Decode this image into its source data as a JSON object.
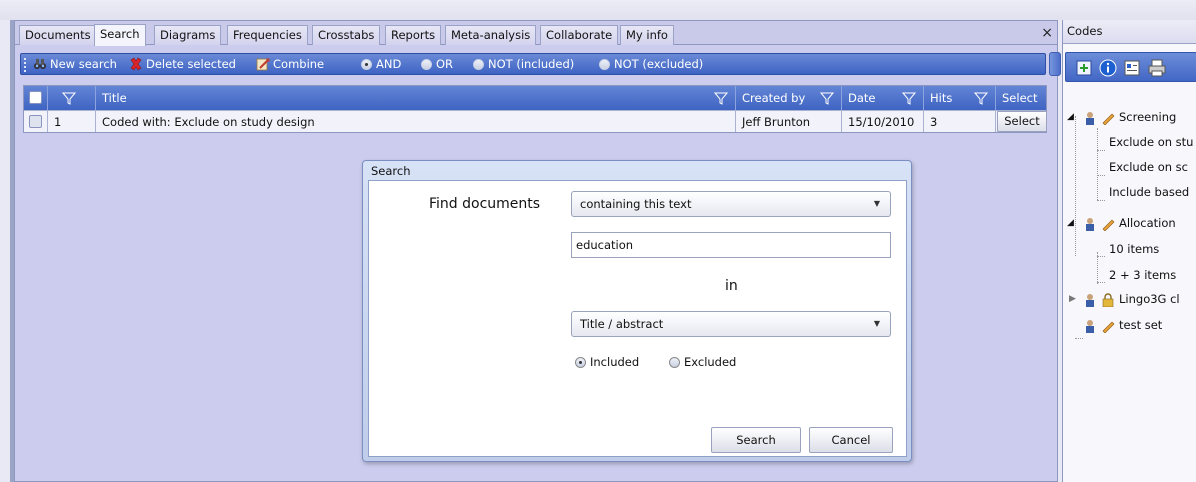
{
  "tabs": [
    "Documents",
    "Search",
    "Diagrams",
    "Frequencies",
    "Crosstabs",
    "Reports",
    "Meta-analysis",
    "Collaborate",
    "My info"
  ],
  "active_tab": "Search",
  "close_label": "×",
  "toolbar": {
    "new_search": "New search",
    "delete_selected": "Delete selected",
    "combine": "Combine",
    "options": [
      "AND",
      "OR",
      "NOT (included)",
      "NOT (excluded)"
    ],
    "selected_option": "AND"
  },
  "grid": {
    "headers": {
      "title": "Title",
      "created_by": "Created by",
      "date": "Date",
      "hits": "Hits",
      "select": "Select"
    },
    "rows": [
      {
        "num": "1",
        "title": "Coded with: Exclude on study design",
        "created_by": "Jeff Brunton",
        "date": "15/10/2010",
        "hits": "3",
        "select": "Select"
      }
    ]
  },
  "dialog": {
    "title": "Search",
    "find_label": "Find documents",
    "mode": "containing this text",
    "query": "education",
    "in_label": "in",
    "field": "Title / abstract",
    "included": "Included",
    "excluded": "Excluded",
    "selected_scope": "Included",
    "search_button": "Search",
    "cancel_button": "Cancel"
  },
  "codes": {
    "title": "Codes",
    "tree": [
      {
        "label": "Screening",
        "level": 0,
        "expanded": true
      },
      {
        "label": "Exclude on stu",
        "level": 1
      },
      {
        "label": "Exclude on sc",
        "level": 1
      },
      {
        "label": "Include based",
        "level": 1
      },
      {
        "label": "Allocation",
        "level": 0,
        "expanded": true
      },
      {
        "label": "10 items",
        "level": 1
      },
      {
        "label": "2 + 3 items",
        "level": 1
      },
      {
        "label": "Lingo3G cl",
        "level": 0,
        "expanded": false,
        "locked": true
      },
      {
        "label": "test set",
        "level": 0
      }
    ]
  },
  "colors": {
    "toolbar_blue": "#3d63c4",
    "header_blue": "#4f74cc",
    "panel_bg": "#ccccee",
    "delete_red": "#d8242a"
  }
}
